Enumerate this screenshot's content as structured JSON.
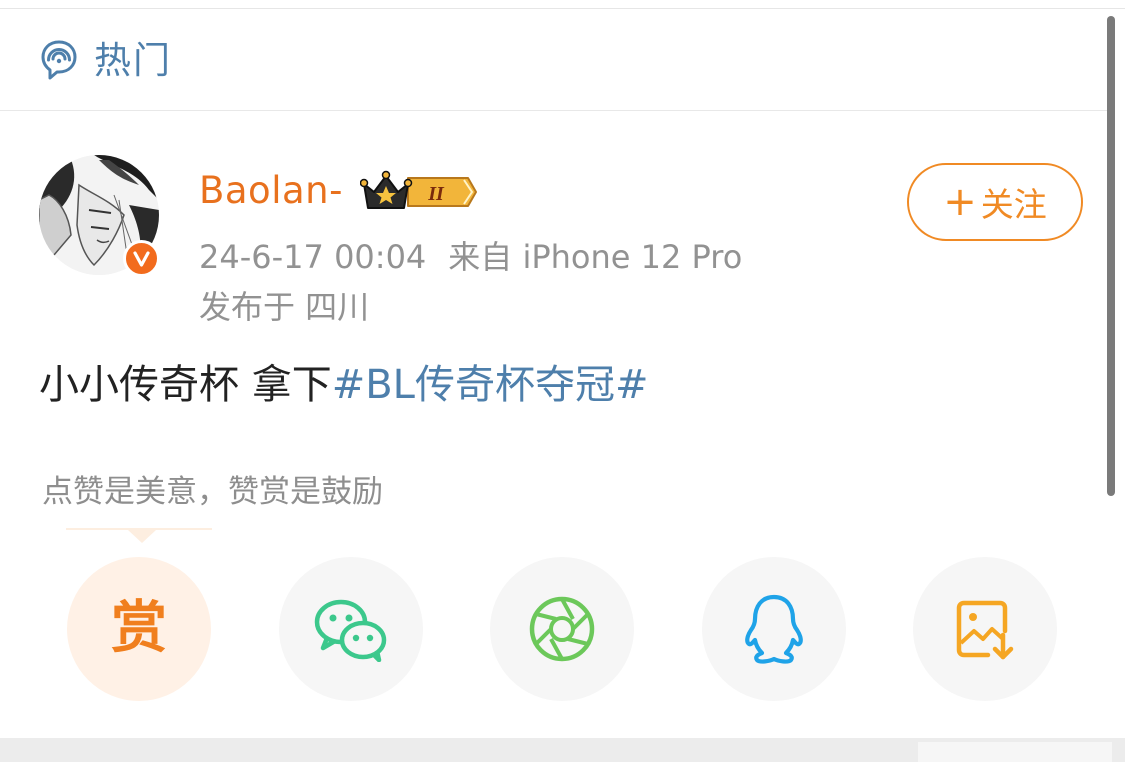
{
  "header": {
    "title": "热门",
    "icon": "hot-topic-icon"
  },
  "post": {
    "author": {
      "name": "Baolan-",
      "avatar_icon": "user-avatar",
      "verified_icon": "verified-v-icon",
      "member_badge": {
        "icon": "crown-badge-icon",
        "level": "II"
      }
    },
    "timestamp": "24-6-17 00:04",
    "source": "来自 iPhone 12 Pro",
    "location": "发布于 四川",
    "follow_label": "关注",
    "follow_plus": "+",
    "text": "小小传奇杯 拿下",
    "hashtag": "#BL传奇杯夺冠#"
  },
  "reward": {
    "tip": "点赞是美意，赞赏是鼓励",
    "button_label": "赏"
  },
  "share": {
    "items": [
      {
        "name": "reward",
        "icon": "reward-icon"
      },
      {
        "name": "wechat",
        "icon": "wechat-icon"
      },
      {
        "name": "moments",
        "icon": "moments-aperture-icon"
      },
      {
        "name": "qq",
        "icon": "qq-penguin-icon"
      },
      {
        "name": "save-image",
        "icon": "save-image-icon"
      }
    ]
  },
  "colors": {
    "accent_orange": "#f08a24",
    "link_blue": "#4e7fab",
    "wechat_green": "#3cc88c",
    "moments_green": "#6cc85a",
    "qq_blue": "#1fa3e8",
    "save_orange": "#f5a623"
  }
}
